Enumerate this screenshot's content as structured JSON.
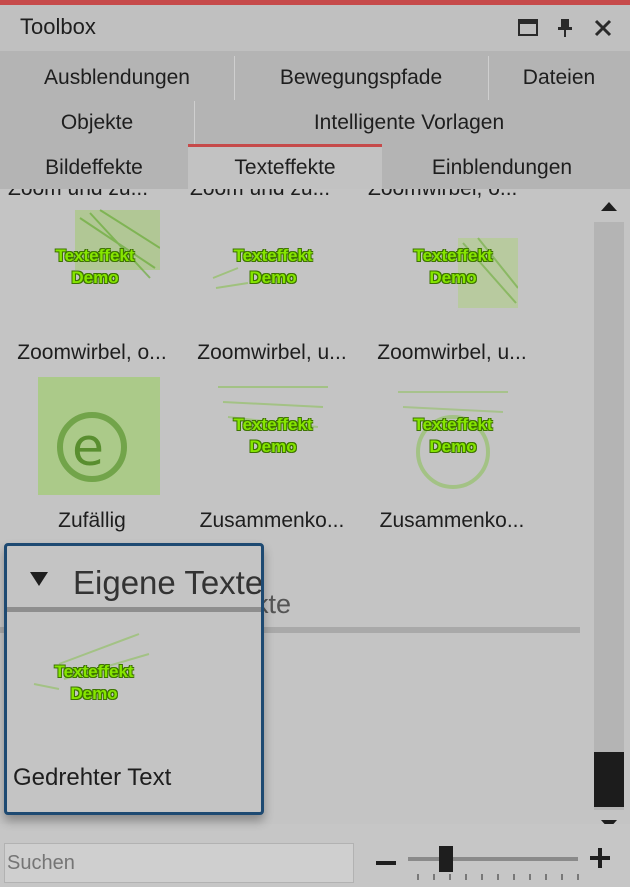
{
  "window": {
    "title": "Toolbox"
  },
  "tabs": {
    "row1": [
      "Ausblendungen",
      "Bewegungspfade",
      "Dateien"
    ],
    "row2": [
      "Objekte",
      "Intelligente Vorlagen"
    ],
    "row3": [
      "Bildeffekte",
      "Texteffekte",
      "Einblendungen"
    ],
    "active": "Texteffekte"
  },
  "cut_row": [
    "Zoom und zu...",
    "Zoom und zu...",
    "Zoomwirbel, o..."
  ],
  "effects": [
    {
      "name": "Zoomwirbel, o...",
      "text1": "Texteffekt",
      "text2": "Demo"
    },
    {
      "name": "Zoomwirbel, u...",
      "text1": "Texteffekt",
      "text2": "Demo"
    },
    {
      "name": "Zoomwirbel, u...",
      "text1": "Texteffekt",
      "text2": "Demo"
    },
    {
      "name": "Zufällig",
      "text1": "",
      "text2": ""
    },
    {
      "name": "Zusammenko...",
      "text1": "Texteffekt",
      "text2": "Demo"
    },
    {
      "name": "Zusammenko...",
      "text1": "Texteffekt",
      "text2": "Demo"
    }
  ],
  "group_partial": "kte",
  "popup": {
    "title": "Eigene Texte",
    "thumb_text1": "Texteffekt",
    "thumb_text2": "Demo",
    "item_name": "Gedrehter Text"
  },
  "search": {
    "placeholder": "Suchen"
  },
  "zoom": {
    "level": 0.2
  },
  "colors": {
    "accent": "#c64a4a",
    "popup_border": "#1e4a72",
    "demo_text": "#86e600"
  }
}
